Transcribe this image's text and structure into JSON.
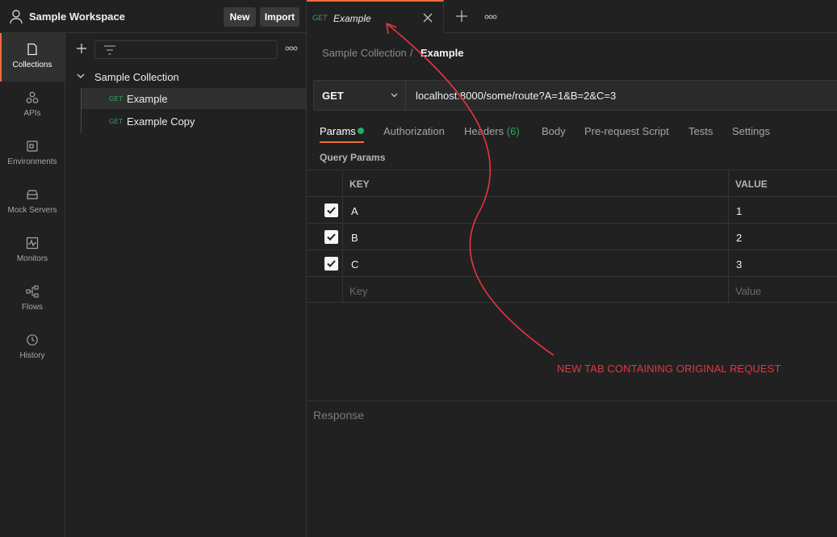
{
  "workspace": {
    "title": "Sample Workspace",
    "new_label": "New",
    "import_label": "Import"
  },
  "sidebar": {
    "items": [
      {
        "label": "Collections",
        "icon": "collections-icon",
        "active": true
      },
      {
        "label": "APIs",
        "icon": "apis-icon"
      },
      {
        "label": "Environments",
        "icon": "environments-icon"
      },
      {
        "label": "Mock Servers",
        "icon": "mock-servers-icon"
      },
      {
        "label": "Monitors",
        "icon": "monitors-icon"
      },
      {
        "label": "Flows",
        "icon": "flows-icon"
      },
      {
        "label": "History",
        "icon": "history-icon"
      }
    ]
  },
  "collections": {
    "collection_name": "Sample Collection",
    "requests": [
      {
        "method": "GET",
        "name": "Example",
        "selected": true
      },
      {
        "method": "GET",
        "name": "Example Copy"
      }
    ]
  },
  "tabs": {
    "active": {
      "method": "GET",
      "name": "Example"
    }
  },
  "breadcrumb": {
    "parent": "Sample Collection",
    "separator": "/",
    "current": "Example"
  },
  "request": {
    "method": "GET",
    "url": "localhost:8000/some/route?A=1&B=2&C=3",
    "tabs": {
      "params": "Params",
      "authorization": "Authorization",
      "headers": "Headers",
      "headers_count": "(6)",
      "body": "Body",
      "prerequest": "Pre-request Script",
      "tests": "Tests",
      "settings": "Settings"
    },
    "query_params_label": "Query Params",
    "table": {
      "key_header": "KEY",
      "value_header": "VALUE",
      "rows": [
        {
          "key": "A",
          "value": "1",
          "checked": true
        },
        {
          "key": "B",
          "value": "2",
          "checked": true
        },
        {
          "key": "C",
          "value": "3",
          "checked": true
        }
      ],
      "key_placeholder": "Key",
      "value_placeholder": "Value"
    }
  },
  "response": {
    "label": "Response"
  },
  "annotation": {
    "text": "NEW TAB CONTAINING ORIGINAL REQUEST",
    "color": "#e8353e"
  },
  "colors": {
    "accent": "#f26b3a",
    "get_method": "#2aa960",
    "background": "#212121"
  }
}
